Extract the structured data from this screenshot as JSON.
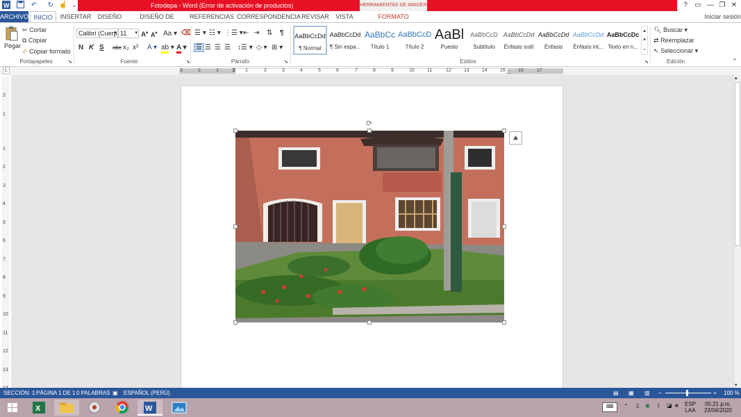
{
  "window": {
    "title": "Fotodepa - Word (Error de activación de productos)",
    "context_tab": "HERRAMIENTAS DE IMAGEN",
    "help_label": "?",
    "signin": "Iniciar sesión"
  },
  "tabs": [
    {
      "label": "ARCHIVO"
    },
    {
      "label": "INICIO"
    },
    {
      "label": "INSERTAR"
    },
    {
      "label": "DISEÑO"
    },
    {
      "label": "DISEÑO DE PÁGINA"
    },
    {
      "label": "REFERENCIAS"
    },
    {
      "label": "CORRESPONDENCIA"
    },
    {
      "label": "REVISAR"
    },
    {
      "label": "VISTA"
    },
    {
      "label": "FORMATO"
    }
  ],
  "clipboard": {
    "paste": "Pegar",
    "cut": "Cortar",
    "copy": "Copiar",
    "format_painter": "Copiar formato",
    "label": "Portapapeles"
  },
  "font": {
    "family": "Calibri (Cuerp",
    "size": "11",
    "bold": "N",
    "italic": "K",
    "underline": "S",
    "strike": "abc",
    "subscript": "x₂",
    "superscript": "x²",
    "grow": "A",
    "shrink": "A",
    "case": "Aa",
    "effects": "A",
    "color_letter": "A",
    "label": "Fuente"
  },
  "paragraph": {
    "label": "Párrafo",
    "pilcrow": "¶"
  },
  "styles": {
    "label": "Estilos",
    "items": [
      {
        "preview": "AaBbCcDd",
        "name": "¶ Normal"
      },
      {
        "preview": "AaBbCcDd",
        "name": "¶ Sin espa..."
      },
      {
        "preview": "AaBbCc",
        "name": "Título 1"
      },
      {
        "preview": "AaBbCcD",
        "name": "Título 2"
      },
      {
        "preview": "AaBl",
        "name": "Puesto"
      },
      {
        "preview": "AaBbCcD",
        "name": "Subtítulo"
      },
      {
        "preview": "AaBbCcDd",
        "name": "Énfasis sutil"
      },
      {
        "preview": "AaBbCcDd",
        "name": "Énfasis"
      },
      {
        "preview": "AaBbCcDd",
        "name": "Énfasis int..."
      },
      {
        "preview": "AaBbCcDc",
        "name": "Texto en n..."
      }
    ]
  },
  "editing": {
    "find": "Buscar",
    "replace": "Reemplazar",
    "select": "Seleccionar",
    "label": "Edición"
  },
  "ruler": {
    "h_ticks": [
      "3",
      "2",
      "1",
      "1",
      "2",
      "3",
      "4",
      "5",
      "6",
      "7",
      "8",
      "9",
      "10",
      "11",
      "12",
      "13",
      "14",
      "15",
      "16",
      "17"
    ],
    "v_ticks": [
      "2",
      "1",
      "1",
      "2",
      "3",
      "4",
      "5",
      "6",
      "7",
      "8",
      "9",
      "10",
      "11",
      "12",
      "13",
      "14"
    ]
  },
  "status": {
    "section": "SECCIÓN: 1",
    "page": "PÁGINA 1 DE 1",
    "words": "0 PALABRAS",
    "language": "ESPAÑOL (PERÚ)",
    "zoom": "100 %"
  },
  "taskbar": {
    "lang_top": "ESP",
    "lang_bottom": "LAA",
    "time": "05:21 p.m.",
    "date": "23/04/2020"
  },
  "colors": {
    "word_blue": "#2b579a",
    "title_red": "#e81123"
  }
}
